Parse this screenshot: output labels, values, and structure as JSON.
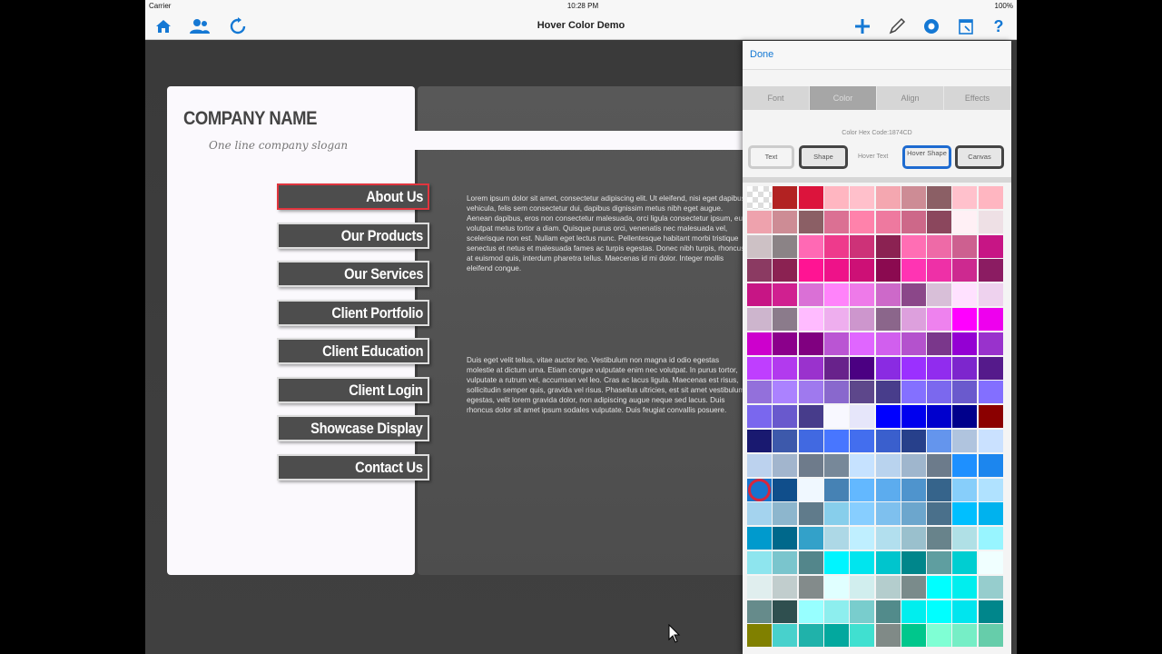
{
  "status": {
    "carrier": "Carrier",
    "time": "10:28 PM",
    "battery": "100%"
  },
  "nav": {
    "title": "Hover Color Demo"
  },
  "site": {
    "company": "COMPANY NAME",
    "slogan": "One line company slogan",
    "menu": [
      "About Us",
      "Our Products",
      "Our Services",
      "Client Portfolio",
      "Client Education",
      "Client Login",
      "Showcase Display",
      "Contact Us"
    ],
    "para1": "Lorem ipsum dolor sit amet, consectetur adipiscing elit. Ut eleifend, nisi eget dapibus vehicula, felis sem consectetur dui, dapibus dignissim metus nibh eget augue. Aenean dapibus, eros non consectetur malesuada, orci ligula consectetur ipsum, eu volutpat metus tortor a diam. Quisque purus orci, venenatis nec malesuada vel, scelerisque non est. Nullam eget lectus nunc. Pellentesque habitant morbi tristique senectus et netus et malesuada fames ac turpis egestas. Donec nibh turpis, rhoncus at euismod quis, interdum pharetra tellus. Maecenas id mi dolor. Integer mollis eleifend congue.",
    "para2": "Duis eget velit tellus, vitae auctor leo. Vestibulum non magna id odio egestas molestie at dictum urna. Etiam congue vulputate enim nec volutpat. In purus tortor, vulputate a rutrum vel, accumsan vel leo. Cras ac lacus ligula. Maecenas est risus, sollicitudin semper quis, gravida vel risus. Phasellus ultricies, est sit amet vestibulum egestas, velit lorem gravida dolor, non adipiscing augue neque sed lacus. Duis rhoncus dolor sit amet ipsum sodales vulputate. Duis feugiat convallis posuere."
  },
  "panel": {
    "done": "Done",
    "tabs": [
      "Font",
      "Color",
      "Align",
      "Effects"
    ],
    "active_tab": "Color",
    "hex_label": "Color Hex Code:1874CD",
    "buttons": {
      "text": "Text",
      "shape": "Shape",
      "hover_text": "Hover Text",
      "hover_shape": "Hover Shape",
      "canvas": "Canvas"
    },
    "selected_color": "#1874CD",
    "palette": [
      [
        "#ffffff",
        "#b22222",
        "#dc143c",
        "#ffb6c1",
        "#ffc0cb",
        "#f4a7b0",
        "#cd8c95",
        "#8b5f65",
        "#ffc1cc",
        "#ffb6c1"
      ],
      [
        "#eea2ad",
        "#cd8c95",
        "#8b5f65",
        "#db7093",
        "#ff82ab",
        "#ee799f",
        "#cd6889",
        "#8b475d",
        "#fff0f5",
        "#eee0e5"
      ],
      [
        "#cdc1c5",
        "#8b8386",
        "#ff69b4",
        "#ee3a8c",
        "#cd3278",
        "#8b2252",
        "#ff6eb4",
        "#ee6aa7",
        "#cd6090",
        "#c71585"
      ],
      [
        "#8b3a62",
        "#8b2252",
        "#ff1493",
        "#ee1289",
        "#cd1076",
        "#8b0a50",
        "#ff34b3",
        "#ee30a7",
        "#cd2990",
        "#8b1c62"
      ],
      [
        "#c71585",
        "#d02090",
        "#da70d6",
        "#ff83fa",
        "#ee7ae9",
        "#cd69c9",
        "#8b4789",
        "#d8bfd8",
        "#ffe1ff",
        "#eed2ee"
      ],
      [
        "#cdb5cd",
        "#8b7b8b",
        "#ffbbff",
        "#eeaeee",
        "#cd96cd",
        "#8b668b",
        "#dda0dd",
        "#ee82ee",
        "#ff00ff",
        "#ee00ee"
      ],
      [
        "#cd00cd",
        "#8b008b",
        "#800080",
        "#ba55d3",
        "#e066ff",
        "#d15fee",
        "#b452cd",
        "#7a378b",
        "#9400d3",
        "#9932cc"
      ],
      [
        "#bf3eff",
        "#b23aee",
        "#9a32cd",
        "#68228b",
        "#4b0082",
        "#8a2be2",
        "#9b30ff",
        "#912cee",
        "#7d26cd",
        "#551a8b"
      ],
      [
        "#9370db",
        "#ab82ff",
        "#9f79ee",
        "#8968cd",
        "#5d478b",
        "#483d8b",
        "#8470ff",
        "#7b68ee",
        "#6a5acd",
        "#836fff"
      ],
      [
        "#7a67ee",
        "#6959cd",
        "#473c8b",
        "#f8f8ff",
        "#e6e6fa",
        "#0000ff",
        "#0000ee",
        "#0000cd",
        "#00008b",
        "#8b0000"
      ],
      [
        "#191970",
        "#3d59ab",
        "#4169e1",
        "#4876ff",
        "#436eee",
        "#3a5fcd",
        "#27408b",
        "#6495ed",
        "#b0c4de",
        "#cae1ff"
      ],
      [
        "#bcd2ee",
        "#a2b5cd",
        "#6e7b8b",
        "#778899",
        "#c6e2ff",
        "#b9d3ee",
        "#9fb6cd",
        "#6c7b8b",
        "#1e90ff",
        "#1c86ee"
      ],
      [
        "#1874cd",
        "#104e8b",
        "#f0f8ff",
        "#4682b4",
        "#63b8ff",
        "#5cacee",
        "#4f94cd",
        "#36648b",
        "#87cefa",
        "#b0e2ff"
      ],
      [
        "#a4d3ee",
        "#8db6cd",
        "#607b8b",
        "#87ceeb",
        "#87ceff",
        "#7ec0ee",
        "#6ca6cd",
        "#4a708b",
        "#00bfff",
        "#00b2ee"
      ],
      [
        "#009acd",
        "#00688b",
        "#33a1c9",
        "#add8e6",
        "#bfefff",
        "#b2dfee",
        "#9ac0cd",
        "#68838b",
        "#b0e0e6",
        "#98f5ff"
      ],
      [
        "#8ee5ee",
        "#7ac5cd",
        "#53868b",
        "#00f5ff",
        "#00e5ee",
        "#00c5cd",
        "#00868b",
        "#5f9ea0",
        "#00ced1",
        "#f0ffff"
      ],
      [
        "#e0eeee",
        "#c1cdcd",
        "#838b8b",
        "#e0ffff",
        "#d1eeee",
        "#b4cdcd",
        "#7a8b8b",
        "#00ffff",
        "#00eeee",
        "#96cdcd"
      ],
      [
        "#668b8b",
        "#2f4f4f",
        "#97ffff",
        "#8deeee",
        "#79cdcd",
        "#528b8b",
        "#00eeee",
        "#00ffff",
        "#00e5ee",
        "#00868b"
      ],
      [
        "#808000",
        "#48d1cc",
        "#20b2aa",
        "#03a89e",
        "#40e0d0",
        "#808a87",
        "#00c78c",
        "#7fffd4",
        "#76eec6",
        "#66cdaa"
      ]
    ]
  }
}
